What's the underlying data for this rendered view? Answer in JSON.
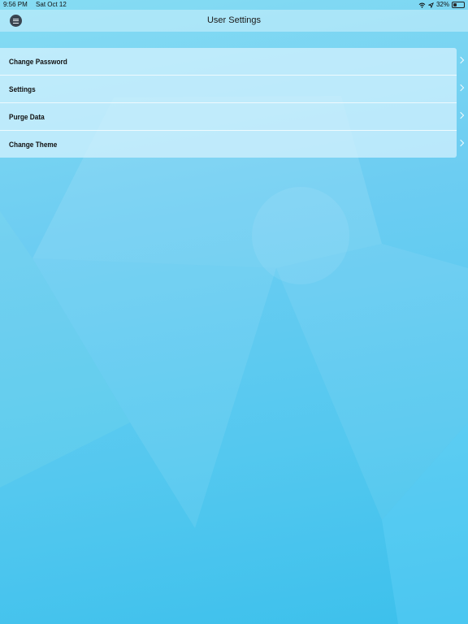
{
  "status_bar": {
    "time": "9:56 PM",
    "date": "Sat Oct 12",
    "battery": "32%",
    "battery_level": 0.32,
    "icons": [
      "wifi-icon",
      "location-icon",
      "battery-icon"
    ]
  },
  "nav": {
    "title": "User Settings",
    "menu_icon": "menu-icon"
  },
  "settings": {
    "items": [
      {
        "label": "Change Password"
      },
      {
        "label": "Settings"
      },
      {
        "label": "Purge Data"
      },
      {
        "label": "Change Theme"
      }
    ]
  },
  "colors": {
    "background_top": "#86dcf3",
    "background_bottom": "#3cc0ec",
    "list_background": "#d7f3fd",
    "menu_button": "#3a4450"
  }
}
